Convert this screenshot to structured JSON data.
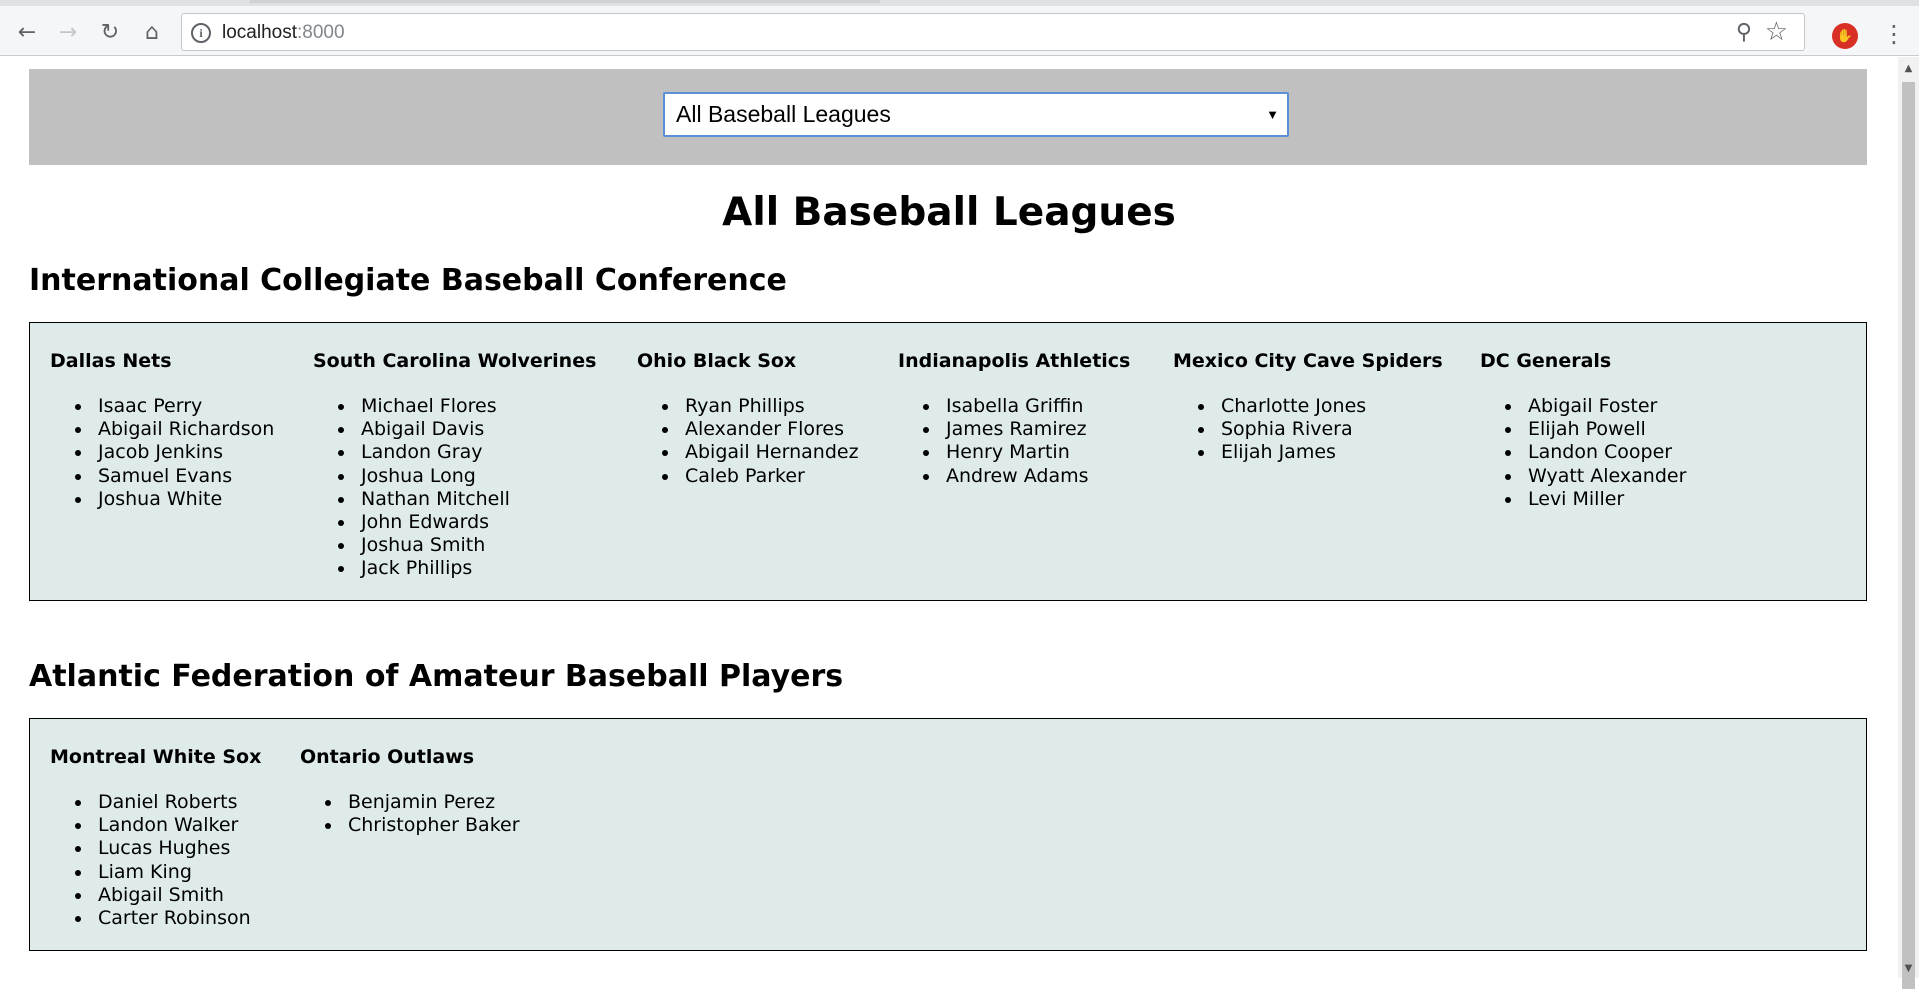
{
  "browser": {
    "url_host": "localhost",
    "url_port": ":8000"
  },
  "selector": {
    "selected": "All Baseball Leagues"
  },
  "page_title": "All Baseball Leagues",
  "leagues": [
    {
      "name": "International Collegiate Baseball Conference",
      "teams": [
        {
          "name": "Dallas Nets",
          "players": [
            "Isaac Perry",
            "Abigail Richardson",
            "Jacob Jenkins",
            "Samuel Evans",
            "Joshua White"
          ]
        },
        {
          "name": "South Carolina Wolverines",
          "players": [
            "Michael Flores",
            "Abigail Davis",
            "Landon Gray",
            "Joshua Long",
            "Nathan Mitchell",
            "John Edwards",
            "Joshua Smith",
            "Jack Phillips"
          ]
        },
        {
          "name": "Ohio Black Sox",
          "players": [
            "Ryan Phillips",
            "Alexander Flores",
            "Abigail Hernandez",
            "Caleb Parker"
          ]
        },
        {
          "name": "Indianapolis Athletics",
          "players": [
            "Isabella Griffin",
            "James Ramirez",
            "Henry Martin",
            "Andrew Adams"
          ]
        },
        {
          "name": "Mexico City Cave Spiders",
          "players": [
            "Charlotte Jones",
            "Sophia Rivera",
            "Elijah James"
          ]
        },
        {
          "name": "DC Generals",
          "players": [
            "Abigail Foster",
            "Elijah Powell",
            "Landon Cooper",
            "Wyatt Alexander",
            "Levi Miller"
          ]
        }
      ]
    },
    {
      "name": "Atlantic Federation of Amateur Baseball Players",
      "teams": [
        {
          "name": "Montreal White Sox",
          "players": [
            "Daniel Roberts",
            "Landon Walker",
            "Lucas Hughes",
            "Liam King",
            "Abigail Smith",
            "Carter Robinson"
          ]
        },
        {
          "name": "Ontario Outlaws",
          "players": [
            "Benjamin Perez",
            "Christopher Baker"
          ]
        }
      ]
    }
  ]
}
